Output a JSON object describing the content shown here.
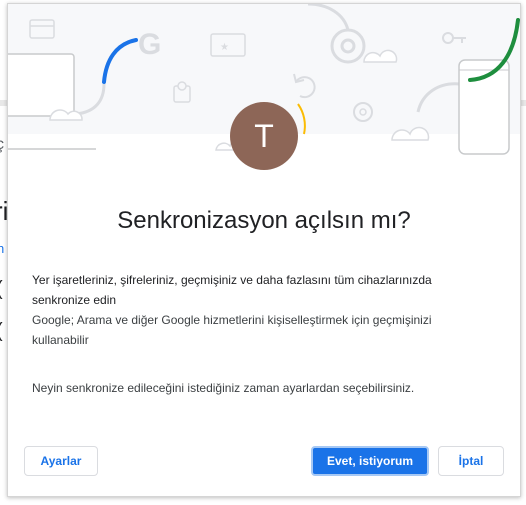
{
  "background": {
    "fragment_1": "ç",
    "fragment_2": "ri",
    "fragment_3": "n",
    "fragment_4": "(",
    "fragment_5": "("
  },
  "dialog": {
    "avatar_letter": "T",
    "title": "Senkronizasyon açılsın mı?",
    "paragraph_1": "Yer işaretleriniz, şifreleriniz, geçmişiniz ve daha fazlasını tüm cihazlarınızda senkronize edin",
    "paragraph_2": "Google; Arama ve diğer Google hizmetlerini kişiselleştirmek için geçmişinizi kullanabilir",
    "paragraph_3": "Neyin senkronize edileceğini istediğiniz zaman ayarlardan seçebilirsiniz.",
    "buttons": {
      "settings": "Ayarlar",
      "confirm": "Evet, istiyorum",
      "cancel": "İptal"
    },
    "illustration_text": "G"
  },
  "colors": {
    "accent": "#1a73e8",
    "avatar": "#8d6657",
    "illustration_green": "#1e8e3e",
    "illustration_blue": "#1a73e8",
    "illustration_gray": "#dadce0",
    "avatar_ring": "#fbbc04"
  }
}
